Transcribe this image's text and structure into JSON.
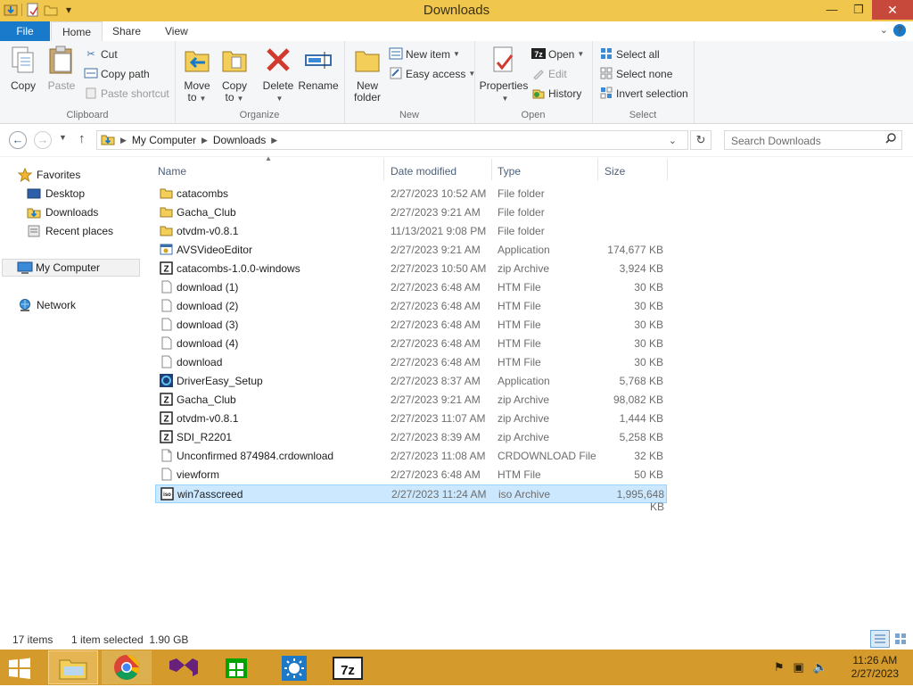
{
  "window": {
    "title": "Downloads"
  },
  "ribbon": {
    "tabs": {
      "file": "File",
      "home": "Home",
      "share": "Share",
      "view": "View"
    },
    "clipboard": {
      "label": "Clipboard",
      "copy": "Copy",
      "paste": "Paste",
      "cut": "Cut",
      "copy_path": "Copy path",
      "paste_shortcut": "Paste shortcut"
    },
    "organize": {
      "label": "Organize",
      "move_to_1": "Move",
      "move_to_2": "to",
      "copy_to_1": "Copy",
      "copy_to_2": "to",
      "delete": "Delete",
      "rename": "Rename"
    },
    "new": {
      "label": "New",
      "new_folder_1": "New",
      "new_folder_2": "folder",
      "new_item": "New item",
      "easy_access": "Easy access"
    },
    "open": {
      "label": "Open",
      "properties": "Properties",
      "open": "Open",
      "edit": "Edit",
      "history": "History"
    },
    "select": {
      "label": "Select",
      "select_all": "Select all",
      "select_none": "Select none",
      "invert_selection": "Invert selection"
    }
  },
  "address": {
    "crumbs": [
      "My Computer",
      "Downloads"
    ],
    "search_placeholder": "Search Downloads"
  },
  "nav": {
    "favorites": "Favorites",
    "desktop": "Desktop",
    "downloads": "Downloads",
    "recent_places": "Recent places",
    "my_computer": "My Computer",
    "network": "Network"
  },
  "list": {
    "headers": {
      "name": "Name",
      "date": "Date modified",
      "type": "Type",
      "size": "Size"
    },
    "rows": [
      {
        "name": "catacombs",
        "date": "2/27/2023 10:52 AM",
        "type": "File folder",
        "size": "",
        "icon": "folder-icon"
      },
      {
        "name": "Gacha_Club",
        "date": "2/27/2023 9:21 AM",
        "type": "File folder",
        "size": "",
        "icon": "folder-icon"
      },
      {
        "name": "otvdm-v0.8.1",
        "date": "11/13/2021 9:08 PM",
        "type": "File folder",
        "size": "",
        "icon": "folder-icon"
      },
      {
        "name": "AVSVideoEditor",
        "date": "2/27/2023 9:21 AM",
        "type": "Application",
        "size": "174,677 KB",
        "icon": "app-icon"
      },
      {
        "name": "catacombs-1.0.0-windows",
        "date": "2/27/2023 10:50 AM",
        "type": "zip Archive",
        "size": "3,924 KB",
        "icon": "7z-archive-icon"
      },
      {
        "name": "download (1)",
        "date": "2/27/2023 6:48 AM",
        "type": "HTM File",
        "size": "30 KB",
        "icon": "document-icon"
      },
      {
        "name": "download (2)",
        "date": "2/27/2023 6:48 AM",
        "type": "HTM File",
        "size": "30 KB",
        "icon": "document-icon"
      },
      {
        "name": "download (3)",
        "date": "2/27/2023 6:48 AM",
        "type": "HTM File",
        "size": "30 KB",
        "icon": "document-icon"
      },
      {
        "name": "download (4)",
        "date": "2/27/2023 6:48 AM",
        "type": "HTM File",
        "size": "30 KB",
        "icon": "document-icon"
      },
      {
        "name": "download",
        "date": "2/27/2023 6:48 AM",
        "type": "HTM File",
        "size": "30 KB",
        "icon": "document-icon"
      },
      {
        "name": "DriverEasy_Setup",
        "date": "2/27/2023 8:37 AM",
        "type": "Application",
        "size": "5,768 KB",
        "icon": "drivereasy-icon"
      },
      {
        "name": "Gacha_Club",
        "date": "2/27/2023 9:21 AM",
        "type": "zip Archive",
        "size": "98,082 KB",
        "icon": "7z-archive-icon"
      },
      {
        "name": "otvdm-v0.8.1",
        "date": "2/27/2023 11:07 AM",
        "type": "zip Archive",
        "size": "1,444 KB",
        "icon": "7z-archive-icon"
      },
      {
        "name": "SDI_R2201",
        "date": "2/27/2023 8:39 AM",
        "type": "zip Archive",
        "size": "5,258 KB",
        "icon": "7z-archive-icon"
      },
      {
        "name": "Unconfirmed 874984.crdownload",
        "date": "2/27/2023 11:08 AM",
        "type": "CRDOWNLOAD File",
        "size": "32 KB",
        "icon": "blank-file-icon"
      },
      {
        "name": "viewform",
        "date": "2/27/2023 6:48 AM",
        "type": "HTM File",
        "size": "50 KB",
        "icon": "document-icon"
      },
      {
        "name": "win7asscreed",
        "date": "2/27/2023 11:24 AM",
        "type": "iso Archive",
        "size": "1,995,648 KB",
        "icon": "iso-archive-icon",
        "selected": true
      }
    ]
  },
  "status": {
    "items": "17 items",
    "selected": "1 item selected  1.90 GB"
  },
  "taskbar": {
    "time": "11:26 AM",
    "date": "2/27/2023"
  }
}
